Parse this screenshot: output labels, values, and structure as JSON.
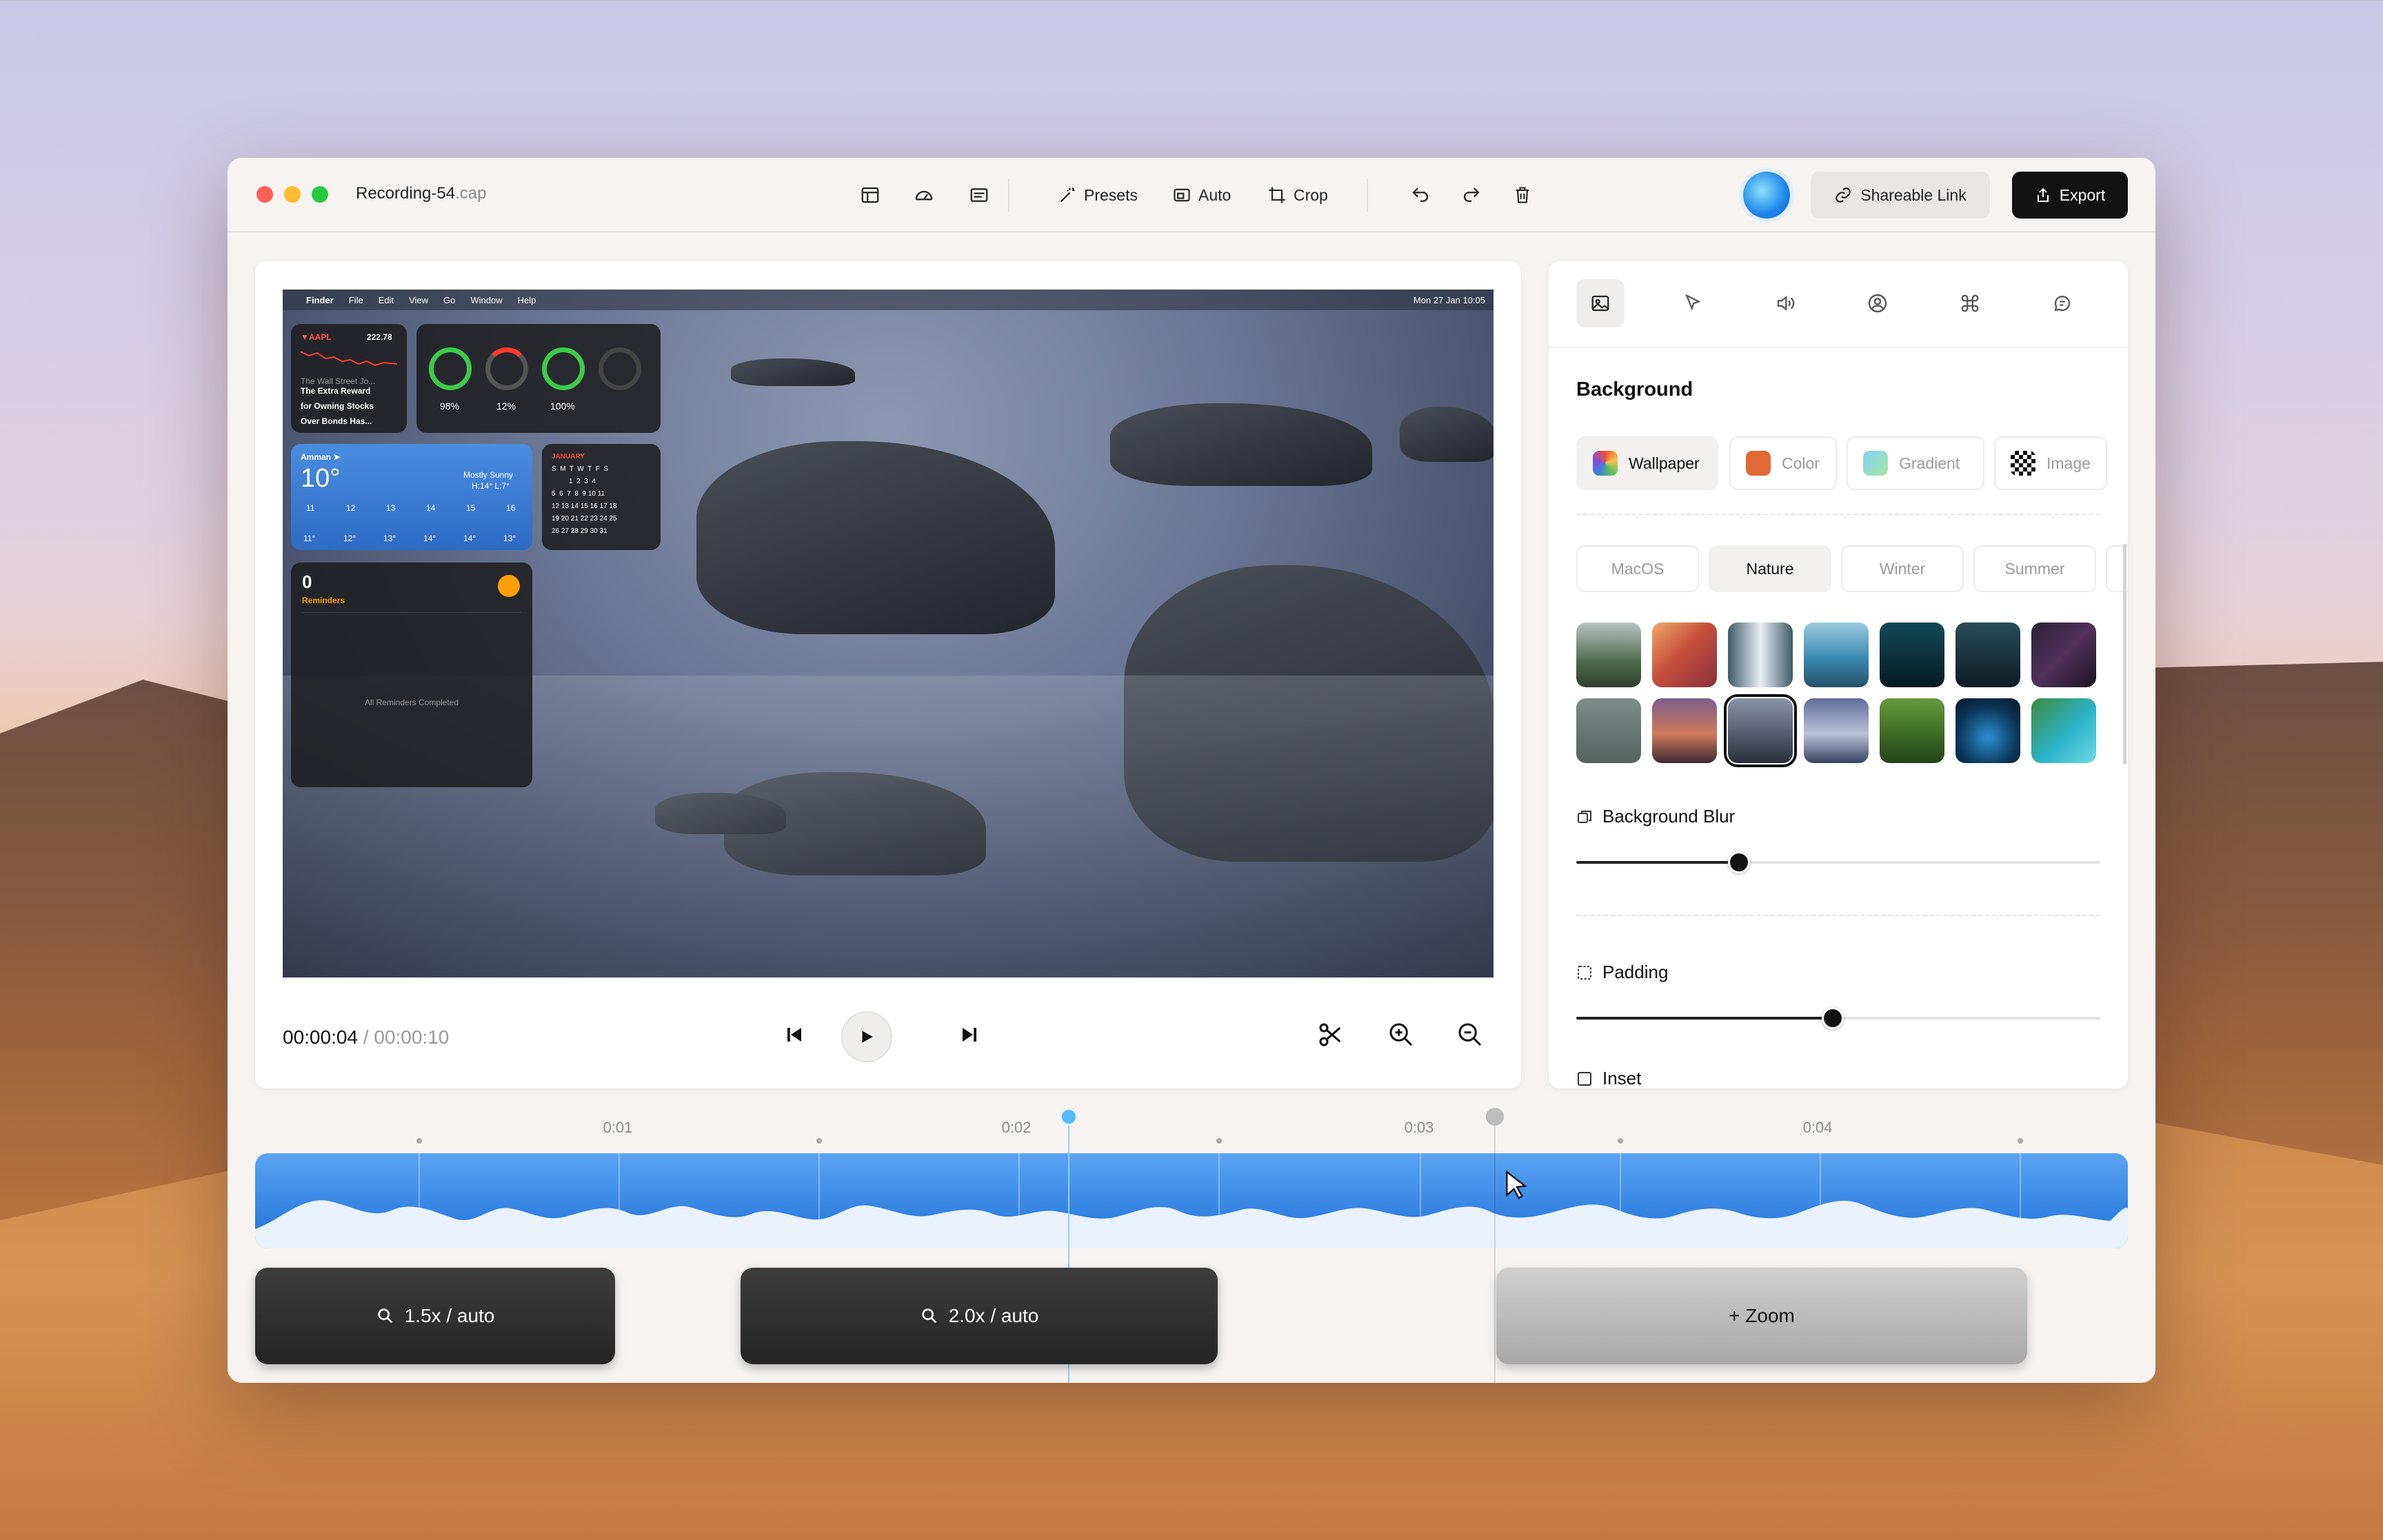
{
  "window": {
    "filename": "Recording-54",
    "ext": ".cap"
  },
  "toolbar": {
    "presets": "Presets",
    "auto": "Auto",
    "crop": "Crop",
    "share": "Shareable Link",
    "export": "Export"
  },
  "screen": {
    "menubar": {
      "apple": "",
      "app": "Finder",
      "items": [
        "File",
        "Edit",
        "View",
        "Go",
        "Window",
        "Help"
      ],
      "clock": "Mon 27 Jan  10:05"
    },
    "stock": {
      "ticker": "▼AAPL",
      "price": "222.78",
      "source": "The Wall Street Jo...",
      "headline1": "The Extra Reward",
      "headline2": "for Owning Stocks",
      "headline3": "Over Bonds Has..."
    },
    "battery": {
      "v1": "98%",
      "v2": "12%",
      "v3": "100%"
    },
    "weather": {
      "city": "Amman ➤",
      "temp": "10°",
      "cond": "Mostly Sunny",
      "hl": "H:14° L:7°",
      "hours": [
        "11",
        "12",
        "13",
        "14",
        "15",
        "16"
      ],
      "temps": [
        "11°",
        "12°",
        "13°",
        "14°",
        "14°",
        "13°"
      ]
    },
    "calendar": {
      "month": "JANUARY",
      "rows": [
        "S  M  T  W  T  F  S",
        "         1  2  3  4",
        "5  6  7  8  9 10 11",
        "12 13 14 15 16 17 18",
        "19 20 21 22 23 24 25",
        "26 27 28 29 30 31"
      ]
    },
    "reminders": {
      "count": "0",
      "title": "Reminders",
      "empty": "All Reminders Completed"
    }
  },
  "playback": {
    "current": "00:00:04",
    "sep": "/",
    "duration": "00:00:10"
  },
  "panel": {
    "heading": "Background",
    "bg_options": [
      "Wallpaper",
      "Color",
      "Gradient",
      "Image"
    ],
    "categories": [
      "MacOS",
      "Nature",
      "Winter",
      "Summer"
    ],
    "blur_label": "Background Blur",
    "blur_value": 0.31,
    "padding_label": "Padding",
    "padding_value": 0.49,
    "inset_label": "Inset"
  },
  "timeline": {
    "marks": [
      "0:01",
      "0:02",
      "0:03",
      "0:04"
    ]
  },
  "zooms": [
    {
      "label": "1.5x / auto"
    },
    {
      "label": "2.0x / auto"
    },
    {
      "label": "+ Zoom"
    }
  ],
  "colors": {
    "accent": "#2f7fe0",
    "playhead": "#55b9ff",
    "export_bg": "#121212"
  }
}
